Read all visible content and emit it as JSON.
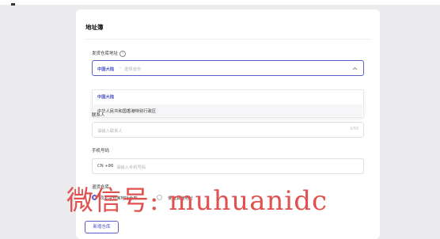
{
  "card": {
    "title": "地址簿"
  },
  "warehouse": {
    "label": "发货仓库地址",
    "help_icon": "question-circle-icon",
    "selected_value": "中国大陆",
    "separator": "-",
    "placeholder": "选择省份",
    "chevron_icon": "chevron-up-icon",
    "options": [
      "中国大陆",
      "中华人民共和国香港特别行政区"
    ]
  },
  "contact": {
    "label": "联系人",
    "placeholder": "请输入联系人",
    "counter": "0/50"
  },
  "phone": {
    "label": "手机号码",
    "country_code": "CN +86",
    "placeholder": "请输入手机号码"
  },
  "return_warehouse": {
    "label": "退货仓库",
    "options": [
      "同发货仓库地址仓库",
      "使用其他地址"
    ],
    "selected_index": 0
  },
  "add_button": {
    "label": "新增仓库"
  },
  "watermark": {
    "text": "微信号: muhuanidc"
  },
  "colors": {
    "accent": "#5b5fc7",
    "watermark": "#e0524f",
    "background": "#ececee"
  }
}
